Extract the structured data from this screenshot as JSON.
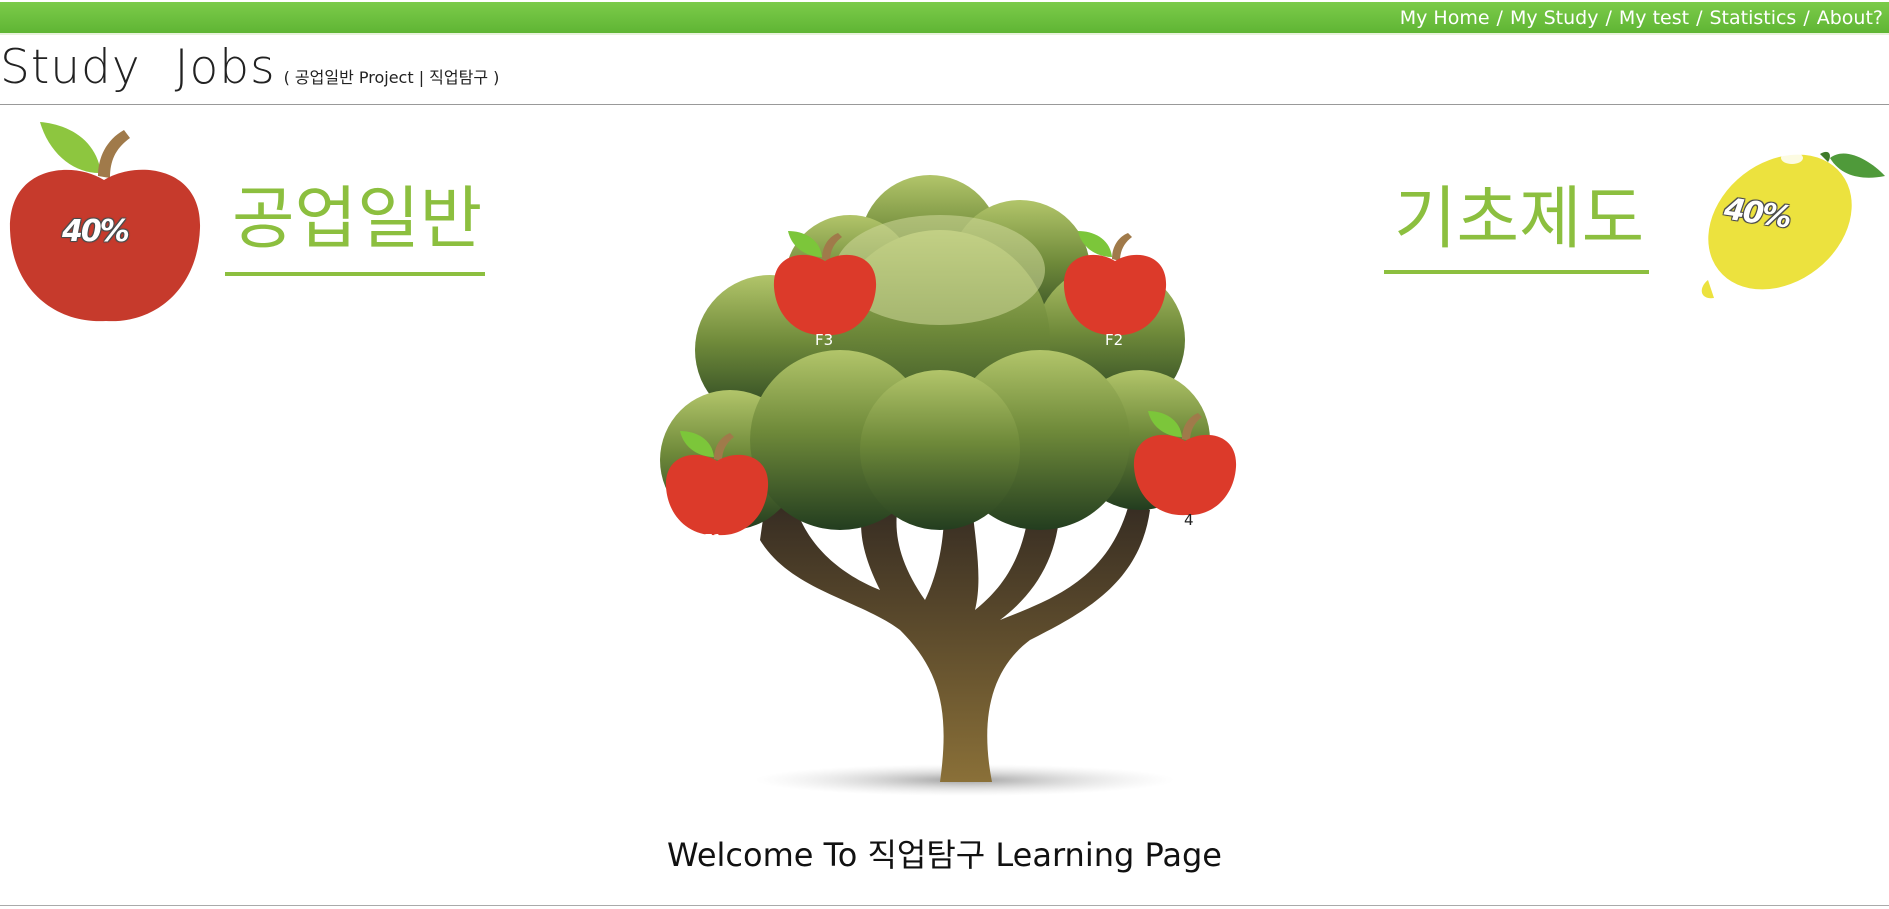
{
  "nav": {
    "items": [
      "My Home",
      "My Study",
      "My test",
      "Statistics",
      "About?"
    ],
    "separator": "/"
  },
  "header": {
    "title": "Study Jobs",
    "subtitle": "( 공업일반 Project | 직업탐구 )"
  },
  "subjects": {
    "left": {
      "label": "공업일반",
      "progress_text": "40%",
      "fruit_icon": "apple-icon"
    },
    "right": {
      "label": "기초제도",
      "progress_text": "40%",
      "fruit_icon": "lemon-icon"
    }
  },
  "tree": {
    "apples": [
      {
        "label": "F3"
      },
      {
        "label": "F2"
      },
      {
        "label": "F1"
      },
      {
        "label": "4"
      }
    ]
  },
  "welcome": "Welcome To 직업탐구 Learning Page",
  "colors": {
    "topbar": "#6cbf3c",
    "accent": "#8cbf3f",
    "apple_red": "#dc3a2a",
    "apple_dark_red": "#c0392b",
    "lemon": "#ece23e"
  }
}
